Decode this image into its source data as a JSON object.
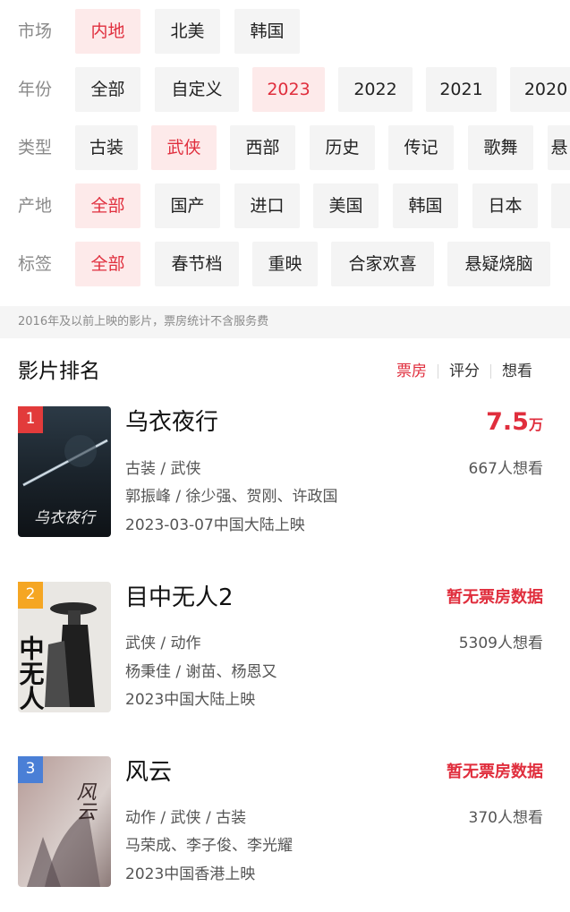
{
  "filters": {
    "market": {
      "label": "市场",
      "options": [
        "内地",
        "北美",
        "韩国"
      ]
    },
    "year": {
      "label": "年份",
      "options": [
        "全部",
        "自定义",
        "2023",
        "2022",
        "2021",
        "2020"
      ]
    },
    "genre": {
      "label": "类型",
      "options": [
        "古装",
        "武侠",
        "西部",
        "历史",
        "传记",
        "歌舞",
        "悬"
      ]
    },
    "origin": {
      "label": "产地",
      "options": [
        "全部",
        "国产",
        "进口",
        "美国",
        "韩国",
        "日本",
        ""
      ]
    },
    "tag": {
      "label": "标签",
      "options": [
        "全部",
        "春节档",
        "重映",
        "合家欢喜",
        "悬疑烧脑"
      ]
    }
  },
  "notice": "2016年及以前上映的影片，票房统计不含服务费",
  "ranking": {
    "title": "影片排名",
    "sort_tabs": [
      "票房",
      "评分",
      "想看"
    ],
    "movies": [
      {
        "rank": "1",
        "title": "乌衣夜行",
        "genres": "古装 / 武侠",
        "people": "郭振峰 / 徐少强、贺刚、许政国",
        "release": "2023-03-07中国大陆上映",
        "box_value": "7.5",
        "box_unit": "万",
        "want": "667人想看",
        "poster_text": "乌衣夜行"
      },
      {
        "rank": "2",
        "title": "目中无人2",
        "genres": "武侠 / 动作",
        "people": "杨秉佳 / 谢苗、杨恩又",
        "release": "2023中国大陆上映",
        "no_box": "暂无票房数据",
        "want": "5309人想看",
        "poster_text": "中无人"
      },
      {
        "rank": "3",
        "title": "风云",
        "genres": "动作 / 武侠 / 古装",
        "people": "马荣成、李子俊、李光耀",
        "release": "2023中国香港上映",
        "no_box": "暂无票房数据",
        "want": "370人想看",
        "poster_text": "风云"
      }
    ]
  },
  "colors": {
    "accent": "#e02e3d",
    "chip_bg": "#f4f4f4",
    "chip_active_bg": "#fdeaea",
    "rank1": "#e23b3b",
    "rank2": "#f5a623",
    "rank3": "#4a7fd6"
  }
}
